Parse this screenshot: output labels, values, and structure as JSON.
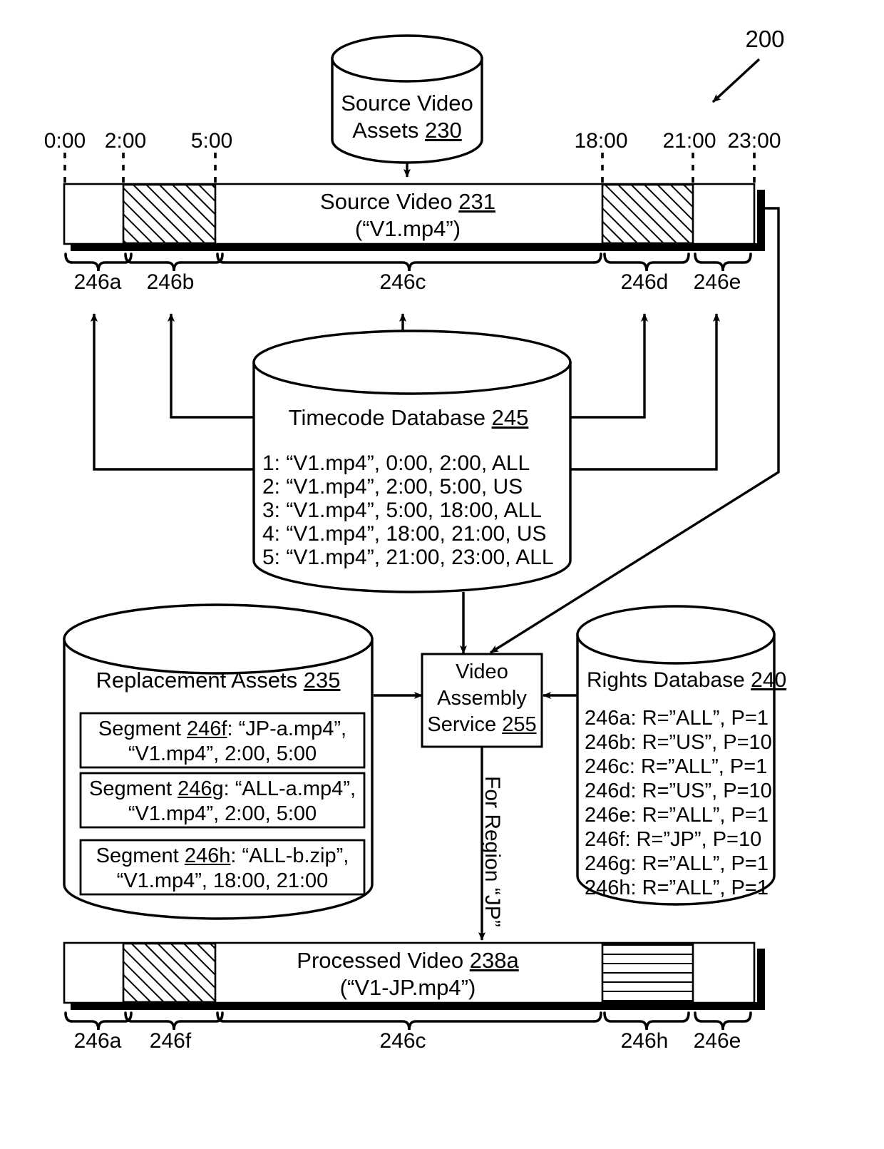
{
  "figure": {
    "ref_number": "200"
  },
  "timeline_top": {
    "ticks": [
      "0:00",
      "2:00",
      "5:00",
      "18:00",
      "21:00",
      "23:00"
    ],
    "title": "Source Video 231",
    "title_text": "Source Video",
    "title_ref": "231",
    "subtitle": "(“V1.mp4”)",
    "segments": [
      "246a",
      "246b",
      "246c",
      "246d",
      "246e"
    ]
  },
  "source_assets": {
    "label": "Source Video",
    "label2": "Assets",
    "ref": "230"
  },
  "timecode_db": {
    "title": "Timecode Database",
    "ref": "245",
    "rows": [
      "1: “V1.mp4”, 0:00, 2:00, ALL",
      "2: “V1.mp4”, 2:00, 5:00, US",
      "3: “V1.mp4”, 5:00, 18:00, ALL",
      "4: “V1.mp4”, 18:00, 21:00, US",
      "5: “V1.mp4”, 21:00, 23:00, ALL"
    ]
  },
  "replacement_assets": {
    "title": "Replacement Assets",
    "ref": "235",
    "segments": [
      {
        "line1_a": "Segment ",
        "line1_ref": "246f",
        "line1_b": ": “JP-a.mp4”,",
        "line2": "“V1.mp4”, 2:00, 5:00"
      },
      {
        "line1_a": "Segment ",
        "line1_ref": "246g",
        "line1_b": ": “ALL-a.mp4”,",
        "line2": "“V1.mp4”, 2:00, 5:00"
      },
      {
        "line1_a": "Segment ",
        "line1_ref": "246h",
        "line1_b": ": “ALL-b.zip”,",
        "line2": "“V1.mp4”, 18:00, 21:00"
      }
    ]
  },
  "rights_db": {
    "title": "Rights Database",
    "ref": "240",
    "rows": [
      "246a: R=”ALL”, P=1",
      "246b: R=”US”, P=10",
      "246c: R=”ALL”, P=1",
      "246d: R=”US”, P=10",
      "246e: R=”ALL”, P=1",
      "246f: R=”JP”, P=10",
      "246g: R=”ALL”, P=1",
      "246h: R=”ALL”, P=1"
    ]
  },
  "assembly_service": {
    "line1": "Video",
    "line2": "Assembly",
    "line3": "Service",
    "ref": "255"
  },
  "region_label": "For Region “JP”",
  "timeline_bottom": {
    "title_text": "Processed Video",
    "title_ref": "238a",
    "subtitle": "(“V1-JP.mp4”)",
    "segments": [
      "246a",
      "246f",
      "246c",
      "246h",
      "246e"
    ]
  },
  "colors": {
    "ink": "#000000",
    "paper": "#ffffff"
  }
}
